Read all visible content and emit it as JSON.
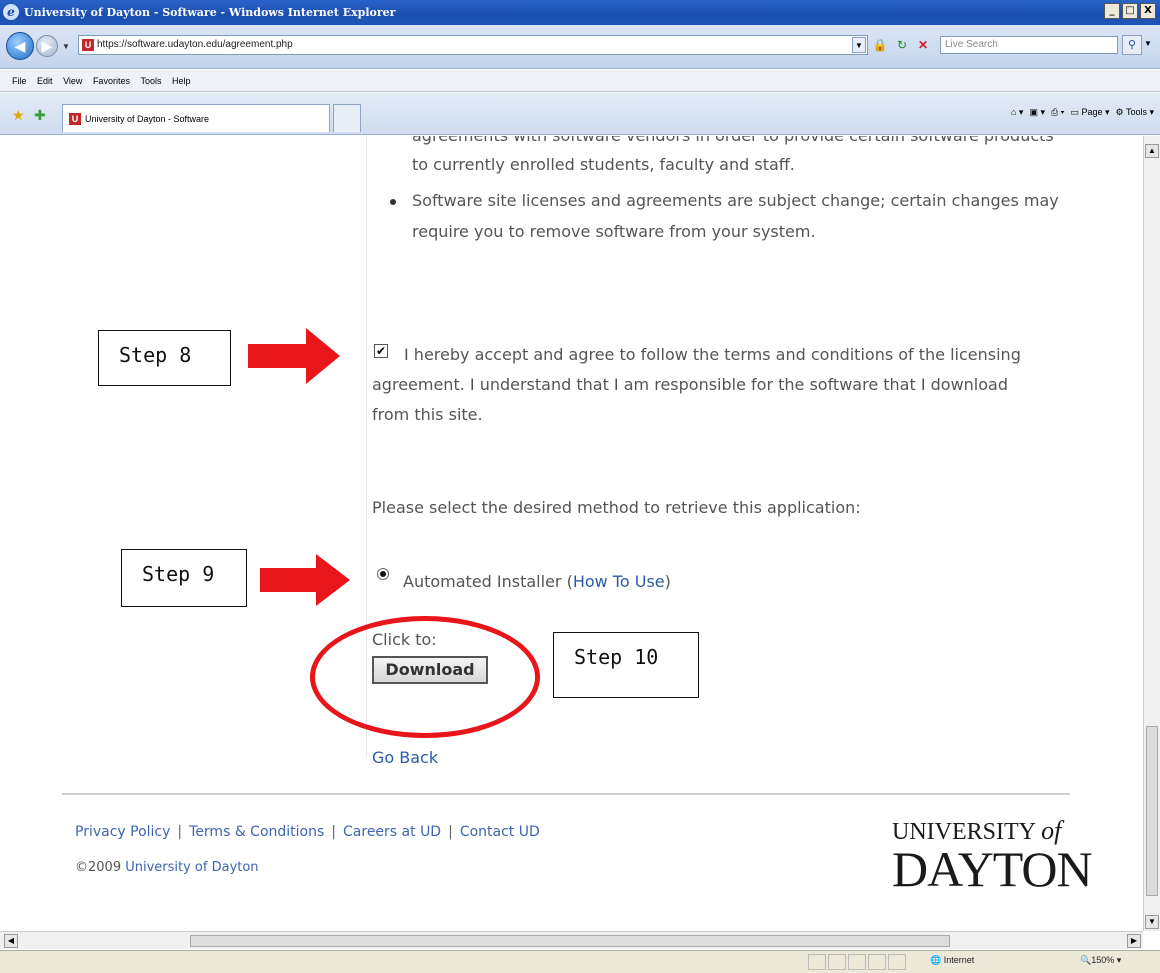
{
  "window": {
    "title": "University of Dayton - Software - Windows Internet Explorer",
    "minimize": "_",
    "maximize": "□",
    "close": "X"
  },
  "address_bar": {
    "url": "https://software.udayton.edu/agreement.php",
    "search_placeholder": "Live Search"
  },
  "menu": [
    "File",
    "Edit",
    "View",
    "Favorites",
    "Tools",
    "Help"
  ],
  "tab": {
    "title": "University of Dayton - Software"
  },
  "command_bar": {
    "page": "Page",
    "tools": "Tools"
  },
  "content": {
    "cut_line": "agreements with software vendors in order to provide certain software products",
    "bullet_continuation": "to currently enrolled students, faculty and staff.",
    "bullet2_line1": "Software site licenses and agreements are subject change; certain changes may",
    "bullet2_line2": "require you to remove software from your system.",
    "accept_text": "I hereby accept and agree to follow the terms and conditions of the licensing agreement. I understand that I am responsible for the software that I download from this site.",
    "checkbox_mark": "✔",
    "method_prompt": "Please select the desired method to retrieve this application:",
    "installer_label": "Automated Installer (",
    "how_to_use": "How To Use",
    "installer_close": ")",
    "click_to": "Click to:",
    "download_button": "Download",
    "go_back": "Go Back"
  },
  "annotations": {
    "step8": "Step 8",
    "step9": "Step 9",
    "step10": "Step 10",
    "arrow_color": "#e8151a"
  },
  "footer": {
    "links": [
      "Privacy Policy",
      "Terms & Conditions",
      "Careers at UD",
      "Contact UD"
    ],
    "separator": "|",
    "copyright_prefix": "©2009 ",
    "copyright_link": "University of Dayton",
    "logo_line1_a": "UNIVERSITY ",
    "logo_line1_b": "of",
    "logo_line2": "DAYTON"
  },
  "status_bar": {
    "zone": "Internet",
    "zoom": "150%"
  }
}
